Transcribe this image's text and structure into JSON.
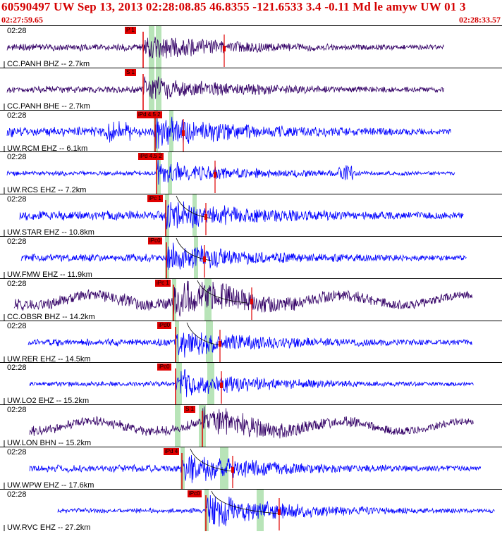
{
  "header": {
    "title": "60590497 UW Sep 13, 2013 02:28:08.85   46.8355 -121.6533  3.4 -0.11 Md le amyw UW 01   3",
    "start_time": "02:27:59.65",
    "end_time": "02:28:33.57"
  },
  "colors": {
    "header": "#d40000",
    "trace_blue": "#0000ff",
    "trace_dark": "#330066",
    "pick": "#e00000",
    "window": "#b8e4b8"
  },
  "panels": [
    {
      "time": "02:28",
      "label": "CC.PANH BHZ -- 2.7km",
      "pick": "P 1",
      "color": "#330066"
    },
    {
      "time": "",
      "label": "CC.PANH BHE -- 2.7km",
      "pick": "S 1",
      "color": "#330066"
    },
    {
      "time": "02:28",
      "label": "UW.RCM EHZ -- 6.1km",
      "pick": "iPd 4.5 2",
      "color": "#0000ff"
    },
    {
      "time": "02:28",
      "label": "UW.RCS EHZ -- 7.2km",
      "pick": "iPd 4.5 2",
      "color": "#0000ff"
    },
    {
      "time": "02:28",
      "label": "UW.STAR EHZ -- 10.8km",
      "pick": "iPc 1",
      "color": "#0000ff"
    },
    {
      "time": "02:28",
      "label": "UW.FMW EHZ -- 11.9km",
      "pick": "iPc0",
      "color": "#0000ff"
    },
    {
      "time": "02:28",
      "label": "CC.OBSR BHZ -- 14.2km",
      "pick": "iPc 1",
      "color": "#330066"
    },
    {
      "time": "02:28",
      "label": "UW.RER EHZ -- 14.5km",
      "pick": "iPd0",
      "color": "#0000ff"
    },
    {
      "time": "02:28",
      "label": "UW.LO2 EHZ -- 15.2km",
      "pick": "iPc0",
      "color": "#0000ff"
    },
    {
      "time": "02:28",
      "label": "UW.LON BHN -- 15.2km",
      "pick": "S 1",
      "color": "#330066"
    },
    {
      "time": "02:28",
      "label": "UW.WPW EHZ -- 17.6km",
      "pick": "iPd 4",
      "color": "#0000ff"
    },
    {
      "time": "02:28",
      "label": "UW.RVC EHZ -- 27.2km",
      "pick": "iPc0",
      "color": "#0000ff"
    }
  ]
}
